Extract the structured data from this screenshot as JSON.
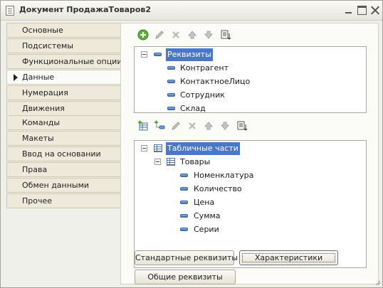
{
  "window": {
    "title": "Документ ПродажаТоваров2",
    "controls": [
      "minimize-icon",
      "maximize-icon",
      "close-icon"
    ]
  },
  "sidebar": {
    "items": [
      {
        "label": "Основные",
        "active": false
      },
      {
        "label": "Подсистемы",
        "active": false
      },
      {
        "label": "Функциональные опции",
        "active": false
      },
      {
        "label": "Данные",
        "active": true
      },
      {
        "label": "Нумерация",
        "active": false
      },
      {
        "label": "Движения",
        "active": false
      },
      {
        "label": "Команды",
        "active": false
      },
      {
        "label": "Макеты",
        "active": false
      },
      {
        "label": "Ввод на основании",
        "active": false
      },
      {
        "label": "Права",
        "active": false
      },
      {
        "label": "Обмен данными",
        "active": false
      },
      {
        "label": "Прочее",
        "active": false
      }
    ]
  },
  "attributes_toolbar": {
    "buttons": [
      "add-icon",
      "edit-icon",
      "delete-icon",
      "move-up-icon",
      "move-down-icon",
      "sort-icon"
    ]
  },
  "attributes_tree": {
    "root": "Реквизиты",
    "items": [
      "Контрагент",
      "КонтактноеЛицо",
      "Сотрудник",
      "Склад"
    ]
  },
  "tables_toolbar": {
    "buttons": [
      "add-table-icon",
      "add-attribute-icon",
      "edit-icon",
      "delete-icon",
      "move-up-icon",
      "move-down-icon",
      "sort-icon"
    ]
  },
  "tables_tree": {
    "root": "Табличные части",
    "table": "Товары",
    "items": [
      "Номенклатура",
      "Количество",
      "Цена",
      "Сумма",
      "Серии"
    ]
  },
  "buttons": {
    "standard_attributes": "Стандартные реквизиты",
    "characteristics": "Характеристики",
    "common_attributes": "Общие реквизиты"
  }
}
